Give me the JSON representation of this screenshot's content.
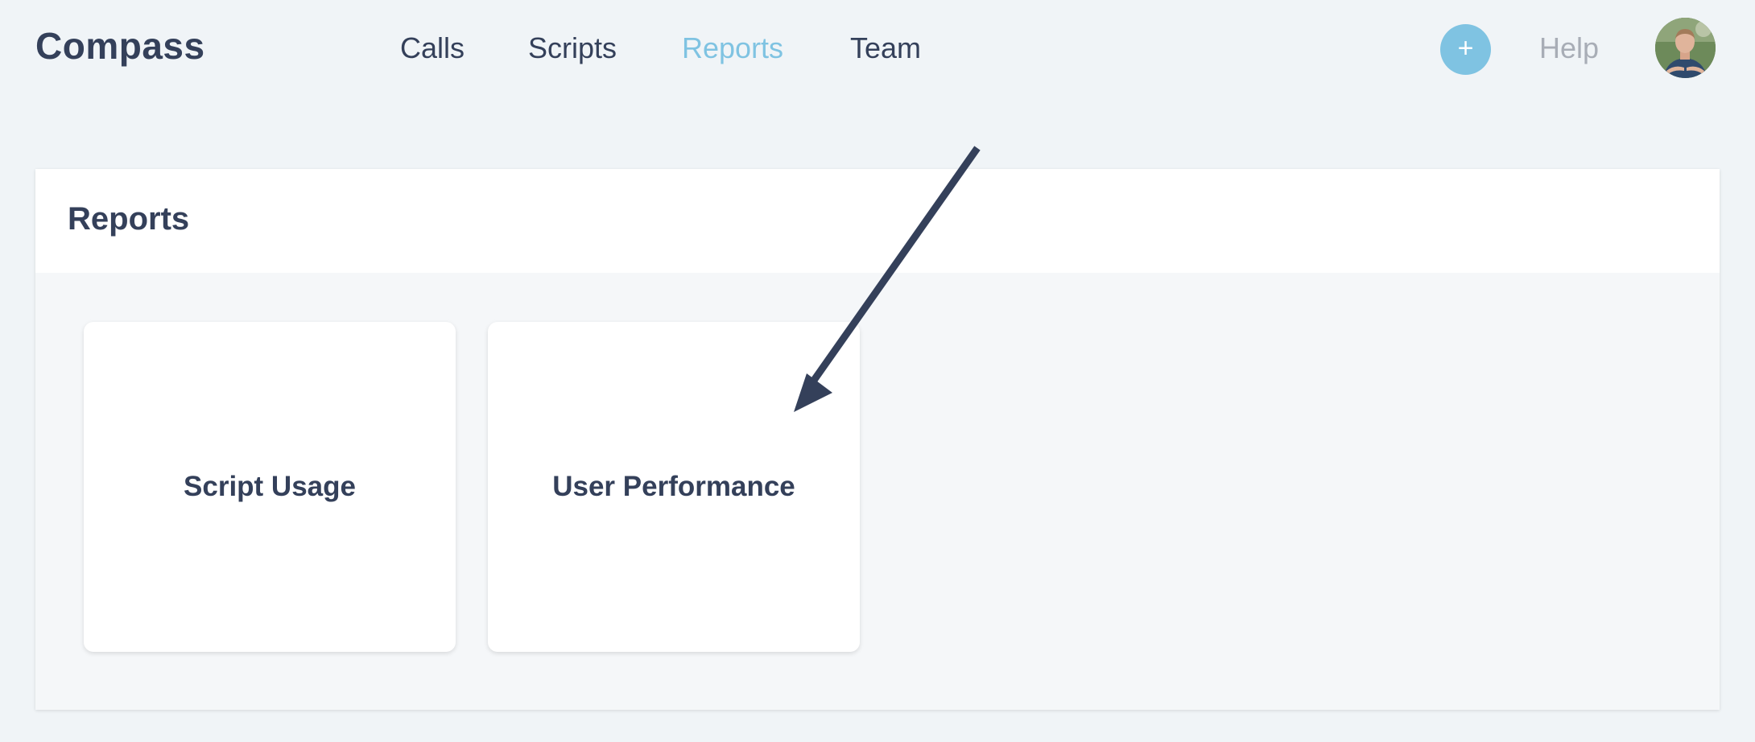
{
  "app": {
    "logo": "Compass"
  },
  "nav": {
    "items": [
      {
        "label": "Calls",
        "active": false
      },
      {
        "label": "Scripts",
        "active": false
      },
      {
        "label": "Reports",
        "active": true
      },
      {
        "label": "Team",
        "active": false
      }
    ]
  },
  "header_actions": {
    "add_label": "+",
    "help_label": "Help",
    "avatar_icon": "user-avatar"
  },
  "page": {
    "title": "Reports",
    "cards": [
      {
        "label": "Script Usage"
      },
      {
        "label": "User Performance"
      }
    ]
  },
  "annotation": {
    "icon": "arrow-pointer-icon",
    "color": "#34405a"
  },
  "colors": {
    "accent": "#7fc3e2",
    "text": "#34405a",
    "muted": "#a8adb6",
    "background": "#f0f4f7"
  }
}
